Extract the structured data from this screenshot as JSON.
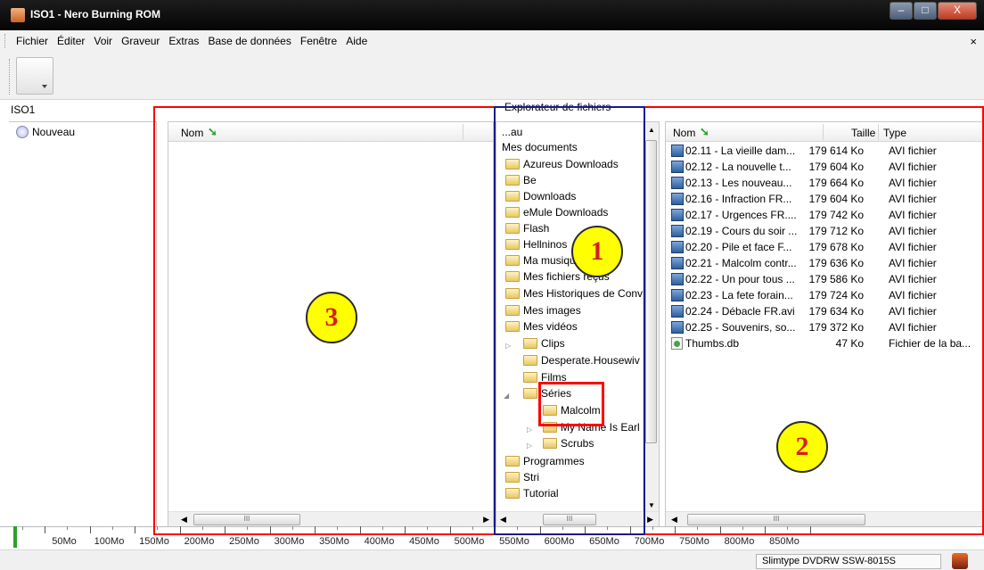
{
  "window": {
    "title": "ISO1 - Nero Burning ROM",
    "minimize": "–",
    "maximize": "□",
    "close": "X"
  },
  "menu": {
    "items": [
      "Fichier",
      "Éditer",
      "Voir",
      "Graveur",
      "Extras",
      "Base de données",
      "Fenêtre",
      "Aide"
    ],
    "close": "×"
  },
  "compilation": {
    "doc_label": "ISO1",
    "new_label": "Nouveau"
  },
  "explorer": {
    "label": "Explorateur de fichiers"
  },
  "left_panel": {
    "col_name": "Nom",
    "scroll_thumb": "III"
  },
  "tree": {
    "items": [
      "...au",
      "Mes documents",
      "Azureus Downloads",
      "Be",
      "Downloads",
      "eMule Downloads",
      "Flash",
      "Hellninos",
      "Ma musique",
      "Mes fichiers reçus",
      "Mes Historiques de Conv",
      "Mes images",
      "Mes vidéos",
      "Clips",
      "Desperate.Housewiv",
      "Films",
      "Séries",
      "Malcolm",
      "My Name Is Earl",
      "Scrubs",
      "Programmes",
      "Stri",
      "Tutorial"
    ],
    "scroll_thumb": "III"
  },
  "files": {
    "col_name": "Nom",
    "col_size": "Taille",
    "col_type": "Type",
    "rows": [
      {
        "name": "02.11 - La vieille dam...",
        "size": "179 614 Ko",
        "type": "AVI fichier"
      },
      {
        "name": "02.12 - La nouvelle t...",
        "size": "179 604 Ko",
        "type": "AVI fichier"
      },
      {
        "name": "02.13 - Les nouveau...",
        "size": "179 664 Ko",
        "type": "AVI fichier"
      },
      {
        "name": "02.16 - Infraction FR...",
        "size": "179 604 Ko",
        "type": "AVI fichier"
      },
      {
        "name": "02.17 - Urgences FR....",
        "size": "179 742 Ko",
        "type": "AVI fichier"
      },
      {
        "name": "02.19 - Cours du soir ...",
        "size": "179 712 Ko",
        "type": "AVI fichier"
      },
      {
        "name": "02.20 - Pile et face F...",
        "size": "179 678 Ko",
        "type": "AVI fichier"
      },
      {
        "name": "02.21 - Malcolm contr...",
        "size": "179 636 Ko",
        "type": "AVI fichier"
      },
      {
        "name": "02.22 - Un pour tous ...",
        "size": "179 586 Ko",
        "type": "AVI fichier"
      },
      {
        "name": "02.23 - La fete forain...",
        "size": "179 724 Ko",
        "type": "AVI fichier"
      },
      {
        "name": "02.24 - Débacle FR.avi",
        "size": "179 634 Ko",
        "type": "AVI fichier"
      },
      {
        "name": "02.25 - Souvenirs, so...",
        "size": "179 372 Ko",
        "type": "AVI fichier"
      },
      {
        "name": "Thumbs.db",
        "size": "47 Ko",
        "type": "Fichier de la ba..."
      }
    ],
    "scroll_thumb": "III"
  },
  "ruler": {
    "labels": [
      "50Mo",
      "100Mo",
      "150Mo",
      "200Mo",
      "250Mo",
      "300Mo",
      "350Mo",
      "400Mo",
      "450Mo",
      "500Mo",
      "550Mo",
      "600Mo",
      "650Mo",
      "700Mo",
      "750Mo",
      "800Mo",
      "850Mo"
    ]
  },
  "status": {
    "drive": "Slimtype DVDRW SSW-8015S"
  },
  "annotations": {
    "badge1": "1",
    "badge2": "2",
    "badge3": "3",
    "colors": {
      "red": "#ff0000",
      "blue": "#1a1a8c",
      "badge_fill": "#ffff00",
      "badge_text": "#d61f1f"
    }
  }
}
